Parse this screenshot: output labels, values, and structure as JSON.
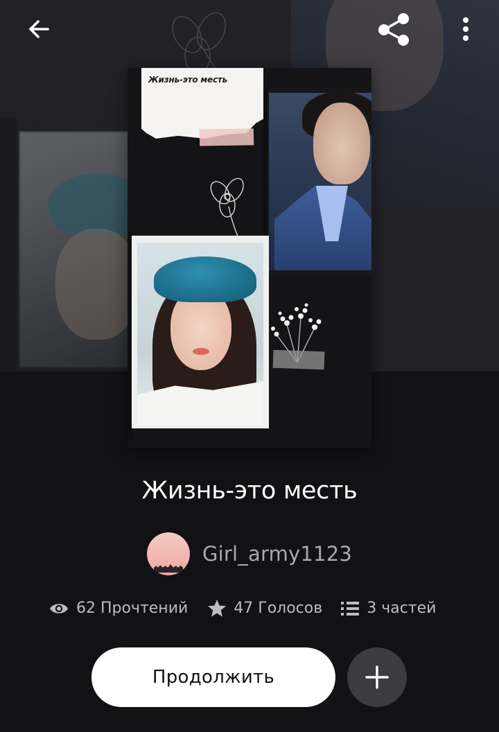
{
  "header": {
    "back_icon": "arrow-left-icon",
    "share_icon": "share-icon",
    "more_icon": "more-vertical-icon"
  },
  "cover": {
    "note_text": "Жизнь-это месть"
  },
  "story": {
    "title": "Жизнь-это месть",
    "author": "Girl_army1123"
  },
  "stats": {
    "reads": "62 Прочтений",
    "votes": "47 Голосов",
    "parts": "3 частей"
  },
  "actions": {
    "continue_label": "Продолжить",
    "add_icon": "plus-icon"
  },
  "colors": {
    "background": "#121114",
    "primary_button": "#ffffff",
    "secondary_button": "#3c3b40",
    "muted_text": "#bdbcc0"
  }
}
